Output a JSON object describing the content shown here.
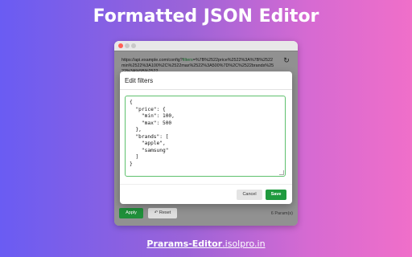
{
  "headline": "Formatted JSON Editor",
  "window": {
    "url_prefix": "https://api.example.com/config?",
    "url_param": "filters",
    "url_rest": "=%7B%2522price%2522%3A%7B%2522min%2522%3A100%2C%2522max%2522%3A500%7D%2C%2522brands%2522%3A%5B%2522",
    "refresh_icon": "refresh-icon"
  },
  "bottom_bar": {
    "apply_label": "Apply",
    "reset_label": "↶ Reset",
    "param_count": "6 Param(s)"
  },
  "modal": {
    "title": "Edit filters",
    "json_text": "{\n  \"price\": {\n    \"min\": 100,\n    \"max\": 500\n  },\n  \"brands\": [\n    \"apple\",\n    \"samsung\"\n  ]\n}",
    "cancel_label": "Cancel",
    "save_label": "Save"
  },
  "footer": {
    "link_part1": "Prarams-Editor",
    "link_part2": ".isolpro.in"
  },
  "colors": {
    "accent_green": "#1f9a3e",
    "editor_border": "#5fc16e"
  }
}
